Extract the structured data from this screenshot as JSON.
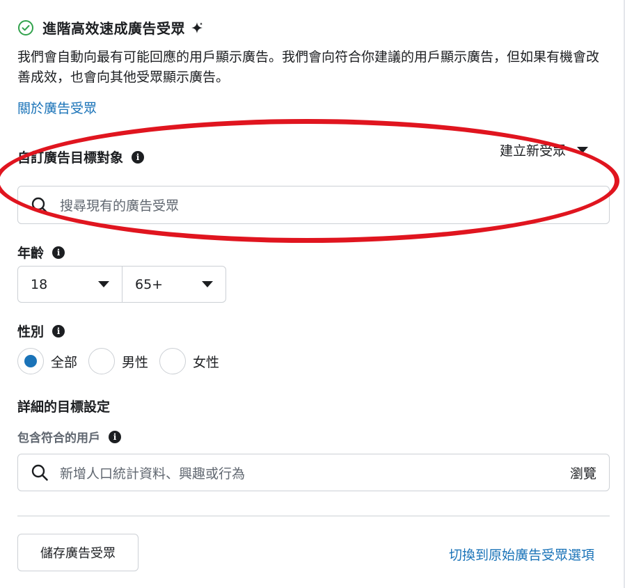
{
  "header": {
    "title": "進階高效速成廣告受眾",
    "description": "我們會自動向最有可能回應的用戶顯示廣告。我們會向符合你建議的用戶顯示廣告，但如果有機會改善成效，也會向其他受眾顯示廣告。",
    "about_link": "關於廣告受眾"
  },
  "custom_audience": {
    "label": "自訂廣告目標對象",
    "create_new": "建立新受眾",
    "search_placeholder": "搜尋現有的廣告受眾"
  },
  "age": {
    "label": "年齡",
    "min": "18",
    "max": "65+"
  },
  "gender": {
    "label": "性別",
    "options": [
      "全部",
      "男性",
      "女性"
    ],
    "selected": "全部"
  },
  "detailed_targeting": {
    "label": "詳細的目標設定",
    "include_label": "包含符合的用戶",
    "search_placeholder": "新增人口統計資料、興趣或行為",
    "browse": "瀏覽"
  },
  "footer": {
    "save_label": "儲存廣告受眾",
    "switch_link": "切換到原始廣告受眾選項"
  },
  "colors": {
    "accent": "#1a73b8",
    "highlight": "#e0151f",
    "check": "#31a24c"
  }
}
